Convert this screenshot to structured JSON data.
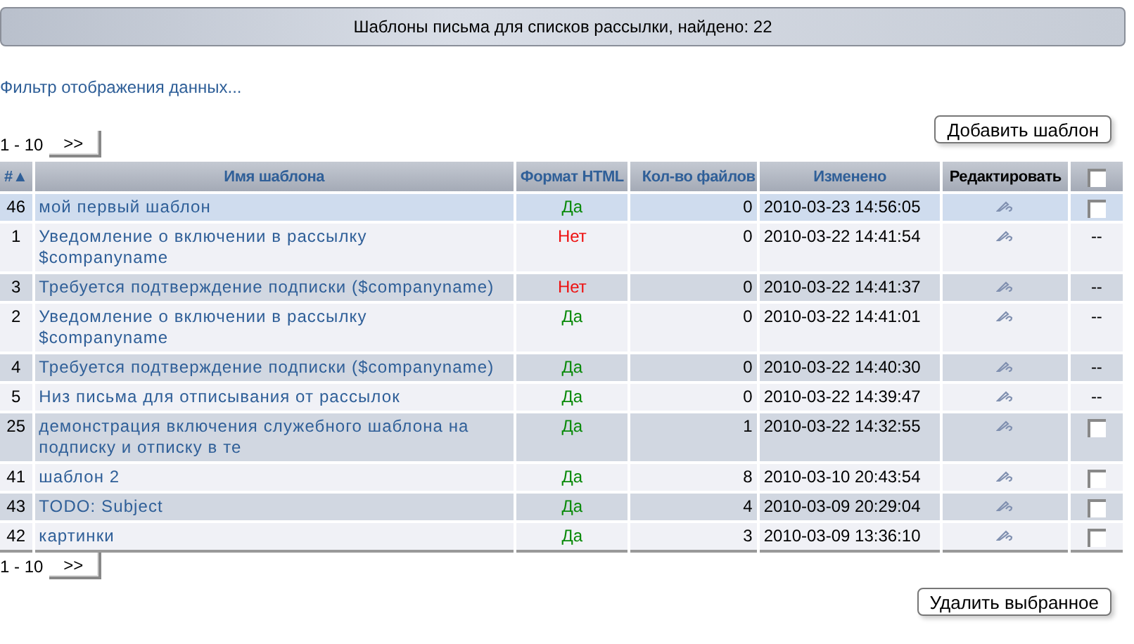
{
  "title": "Шаблоны письма для списков рассылки, найдено: 22",
  "filter_link": "Фильтр отображения данных...",
  "pager_top": {
    "range": "1 - 10",
    "next": ">>"
  },
  "add_button": "Добавить шаблон",
  "table": {
    "columns": [
      {
        "label": "#",
        "sort": "▲"
      },
      {
        "label": "Имя шаблона"
      },
      {
        "label": "Формат HTML"
      },
      {
        "label": "Кол-во файлов"
      },
      {
        "label": "Изменено"
      },
      {
        "label": "Редактировать"
      },
      {
        "kind": "checkbox",
        "checked": false
      }
    ],
    "rows": [
      {
        "id": "46",
        "name": "мой первый шаблон",
        "html": {
          "text": "Да",
          "on": true
        },
        "files": "0",
        "changed": "2010-03-23 14:56:05",
        "selected": true,
        "select": {
          "kind": "checkbox",
          "checked": false
        }
      },
      {
        "id": "1",
        "name": "Уведомление о включении в рассылку $companyname",
        "html": {
          "text": "Нет",
          "on": false
        },
        "files": "0",
        "changed": "2010-03-22 14:41:54",
        "selected": false,
        "select": {
          "kind": "text",
          "text": "--"
        }
      },
      {
        "id": "3",
        "name": "Требуется подтверждение подписки ($companyname)",
        "html": {
          "text": "Нет",
          "on": false
        },
        "files": "0",
        "changed": "2010-03-22 14:41:37",
        "selected": false,
        "select": {
          "kind": "text",
          "text": "--"
        }
      },
      {
        "id": "2",
        "name": "Уведомление о включении в рассылку $companyname",
        "html": {
          "text": "Да",
          "on": true
        },
        "files": "0",
        "changed": "2010-03-22 14:41:01",
        "selected": false,
        "select": {
          "kind": "text",
          "text": "--"
        }
      },
      {
        "id": "4",
        "name": "Требуется подтверждение подписки ($companyname)",
        "html": {
          "text": "Да",
          "on": true
        },
        "files": "0",
        "changed": "2010-03-22 14:40:30",
        "selected": false,
        "select": {
          "kind": "text",
          "text": "--"
        }
      },
      {
        "id": "5",
        "name": "Низ письма для отписывания от рассылок",
        "html": {
          "text": "Да",
          "on": true
        },
        "files": "0",
        "changed": "2010-03-22 14:39:47",
        "selected": false,
        "select": {
          "kind": "text",
          "text": "--"
        }
      },
      {
        "id": "25",
        "name": "демонстрация включения служебного шаблона на подписку и отписку в те",
        "html": {
          "text": "Да",
          "on": true
        },
        "files": "1",
        "changed": "2010-03-22 14:32:55",
        "selected": false,
        "select": {
          "kind": "checkbox",
          "checked": false
        }
      },
      {
        "id": "41",
        "name": "шаблон 2",
        "html": {
          "text": "Да",
          "on": true
        },
        "files": "8",
        "changed": "2010-03-10 20:43:54",
        "selected": false,
        "select": {
          "kind": "checkbox",
          "checked": false
        }
      },
      {
        "id": "43",
        "name": "TODO: Subject",
        "html": {
          "text": "Да",
          "on": true
        },
        "files": "4",
        "changed": "2010-03-09 20:29:04",
        "selected": false,
        "select": {
          "kind": "checkbox",
          "checked": false
        }
      },
      {
        "id": "42",
        "name": "картинки",
        "html": {
          "text": "Да",
          "on": true
        },
        "files": "3",
        "changed": "2010-03-09 13:36:10",
        "selected": false,
        "select": {
          "kind": "checkbox",
          "checked": false
        }
      }
    ]
  },
  "pager_bottom": {
    "range": "1 - 10",
    "next": ">>"
  },
  "delete_button": "Удалить выбранное"
}
